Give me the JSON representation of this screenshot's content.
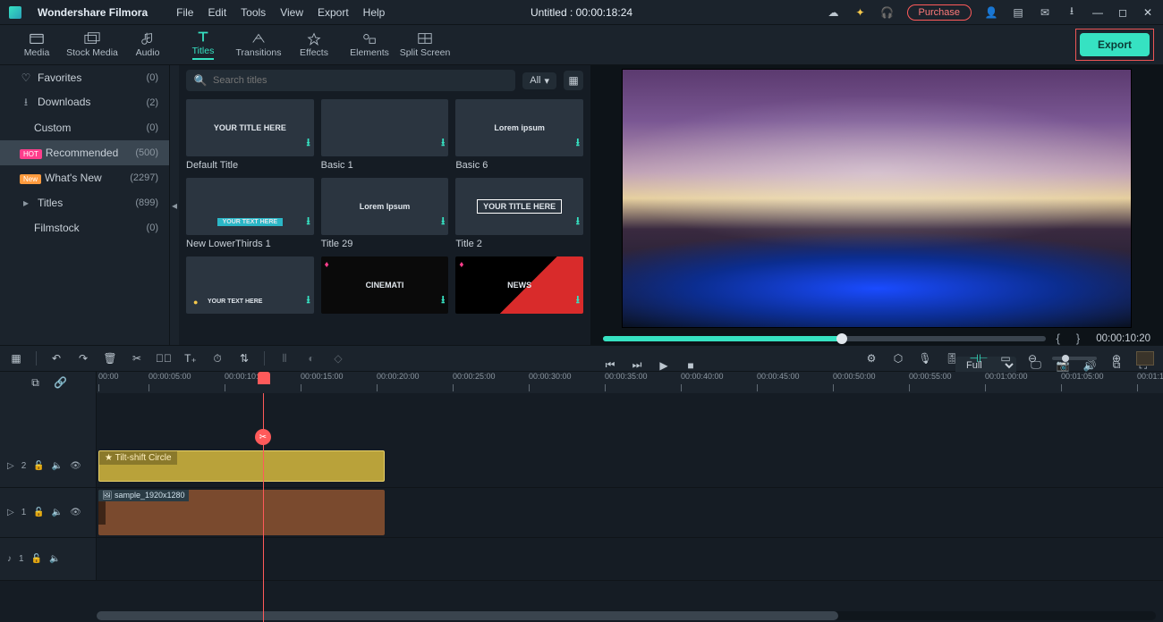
{
  "app": {
    "name": "Wondershare Filmora"
  },
  "menus": [
    "File",
    "Edit",
    "Tools",
    "View",
    "Export",
    "Help"
  ],
  "doc": {
    "title": "Untitled : 00:00:18:24"
  },
  "header": {
    "purchase": "Purchase"
  },
  "toolbar": {
    "items": [
      {
        "label": "Media"
      },
      {
        "label": "Stock Media"
      },
      {
        "label": "Audio"
      },
      {
        "label": "Titles"
      },
      {
        "label": "Transitions"
      },
      {
        "label": "Effects"
      },
      {
        "label": "Elements"
      },
      {
        "label": "Split Screen"
      }
    ],
    "active_index": 3,
    "export": "Export"
  },
  "sidebar": {
    "items": [
      {
        "icon": "heart",
        "label": "Favorites",
        "count": "(0)"
      },
      {
        "icon": "download",
        "label": "Downloads",
        "count": "(2)"
      },
      {
        "icon": "",
        "label": "Custom",
        "count": "(0)",
        "indent": true
      },
      {
        "tag": "HOT",
        "label": "Recommended",
        "count": "(500)",
        "selected": true
      },
      {
        "tag": "New",
        "label": "What's New",
        "count": "(2297)"
      },
      {
        "icon": "caret",
        "label": "Titles",
        "count": "(899)"
      },
      {
        "icon": "",
        "label": "Filmstock",
        "count": "(0)",
        "indent": true
      }
    ]
  },
  "search": {
    "placeholder": "Search titles",
    "filter": "All"
  },
  "assets": [
    {
      "thumb_text": "YOUR TITLE HERE",
      "label": "Default Title"
    },
    {
      "thumb_text": "",
      "label": "Basic 1"
    },
    {
      "thumb_text": "Lorem ipsum",
      "label": "Basic 6"
    },
    {
      "thumb_text": "YOUR TEXT HERE",
      "label": "New LowerThirds 1",
      "lower": true
    },
    {
      "thumb_text": "Lorem Ipsum",
      "label": "Title 29"
    },
    {
      "thumb_text": "YOUR TITLE HERE",
      "label": "Title 2",
      "boxed": true
    },
    {
      "thumb_text": "YOUR TEXT HERE",
      "label": "",
      "badge": true
    },
    {
      "thumb_text": "CINEMATI",
      "label": "",
      "dark": true,
      "gem": true
    },
    {
      "thumb_text": "NEWS",
      "label": "",
      "news": true,
      "gem": true
    }
  ],
  "preview": {
    "timecode": "00:00:10:20",
    "quality": "Full"
  },
  "ruler": {
    "start": "00:00",
    "ticks": [
      "00:00:05:00",
      "00:00:10:00",
      "00:00:15:00",
      "00:00:20:00",
      "00:00:25:00",
      "00:00:30:00",
      "00:00:35:00",
      "00:00:40:00",
      "00:00:45:00",
      "00:00:50:00",
      "00:00:55:00",
      "00:01:00:00",
      "00:01:05:00",
      "00:01:1"
    ]
  },
  "tracks": {
    "t2": {
      "label": "2"
    },
    "t1": {
      "label": "1"
    },
    "a1": {
      "label": "1"
    },
    "effect_clip": {
      "name": "Tilt-shift Circle"
    },
    "video_clip": {
      "name": "sample_1920x1280"
    }
  },
  "colors": {
    "accent": "#36e2c2",
    "danger": "#ff5a5a"
  }
}
